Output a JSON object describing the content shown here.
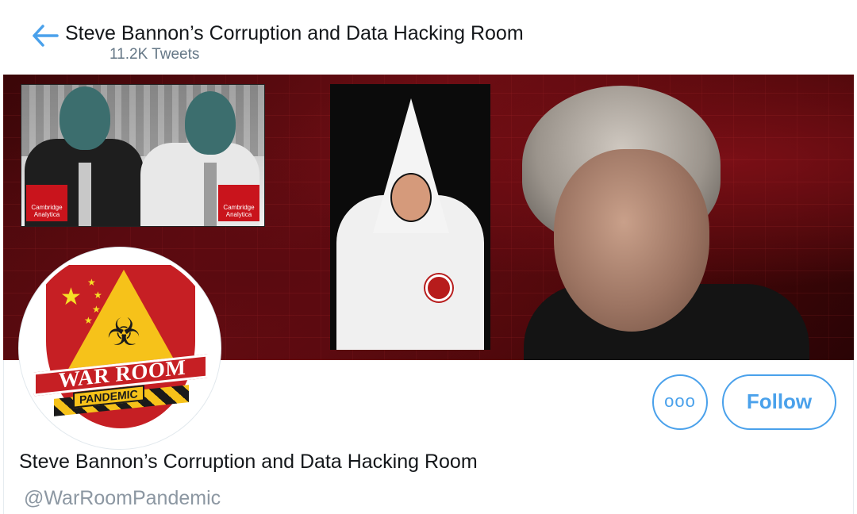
{
  "header": {
    "title": "Steve Bannon’s Corruption and Data Hacking Room",
    "tweet_count": "11.2K Tweets"
  },
  "banner": {
    "badge_left": "Cambridge Analytica",
    "badge_right": "Cambridge Analytica"
  },
  "avatar": {
    "line1": "WAR ROOM",
    "line2": "PANDEMIC"
  },
  "actions": {
    "more_label": "ooo",
    "follow_label": "Follow"
  },
  "profile": {
    "display_name": "Steve Bannon’s Corruption and Data Hacking Room",
    "handle": "@WarRoomPandemic"
  },
  "colors": {
    "accent": "#4aa1eb",
    "banner_red": "#6b0d13",
    "hazard_yellow": "#f6c21a"
  },
  "icons": {
    "back": "arrow-left-icon",
    "more": "more-options-icon"
  }
}
